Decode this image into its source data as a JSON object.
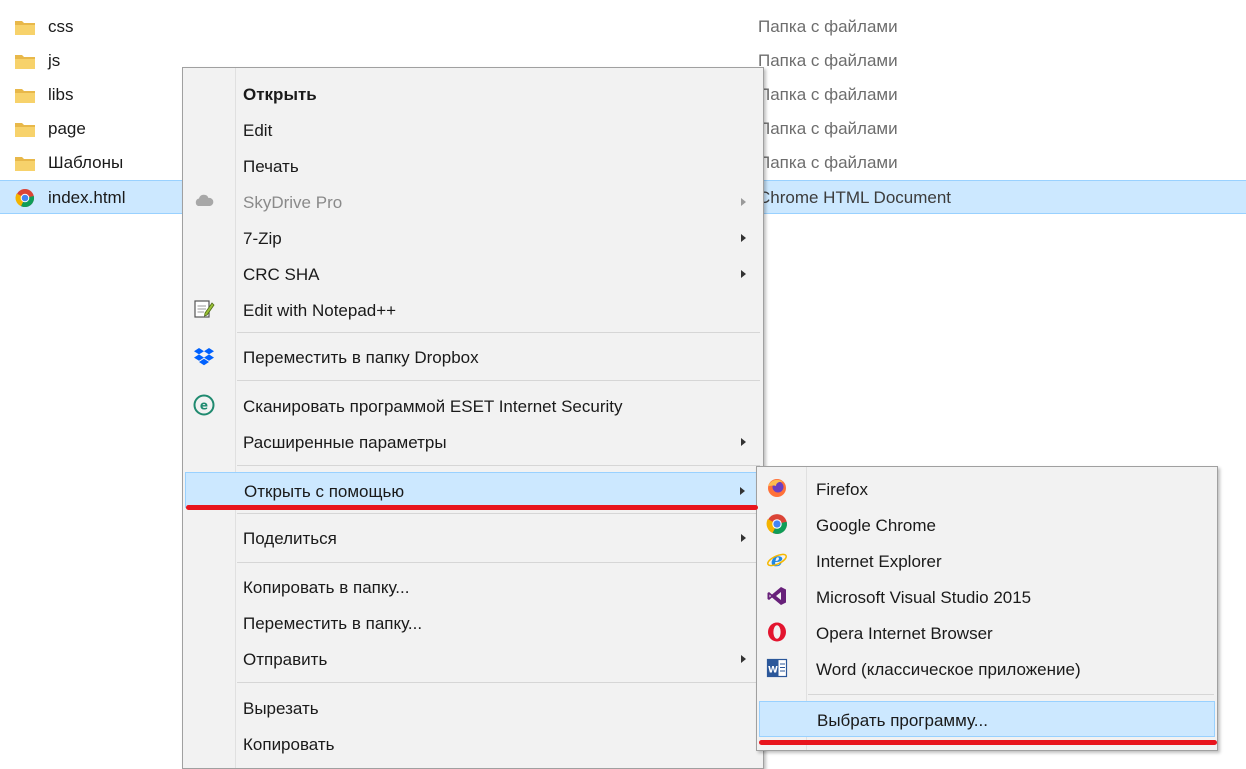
{
  "files": [
    {
      "name": "css",
      "type": "Папка с файлами",
      "icon": "folder-icon"
    },
    {
      "name": "js",
      "type": "Папка с файлами",
      "icon": "folder-icon"
    },
    {
      "name": "libs",
      "type": "Папка с файлами",
      "icon": "folder-icon"
    },
    {
      "name": "page",
      "type": "Папка с файлами",
      "icon": "folder-icon"
    },
    {
      "name": "Шаблоны",
      "type": "Папка с файлами",
      "icon": "folder-icon"
    },
    {
      "name": "index.html",
      "type": "Chrome HTML Document",
      "icon": "chrome-icon",
      "selected": true
    }
  ],
  "context_menu": {
    "open": "Открыть",
    "edit": "Edit",
    "print": "Печать",
    "skydrive": "SkyDrive Pro",
    "zip": "7-Zip",
    "crc": "CRC SHA",
    "notepad": "Edit with Notepad++",
    "dropbox": "Переместить в папку Dropbox",
    "eset": "Сканировать программой ESET Internet Security",
    "advanced": "Расширенные параметры",
    "open_with": "Открыть с помощью",
    "share": "Поделиться",
    "copy_to": "Копировать в папку...",
    "move_to": "Переместить в папку...",
    "send_to": "Отправить",
    "cut": "Вырезать",
    "copy": "Копировать"
  },
  "submenu": {
    "firefox": "Firefox",
    "chrome": "Google Chrome",
    "ie": "Internet Explorer",
    "vs": "Microsoft Visual Studio 2015",
    "opera": "Opera Internet Browser",
    "word": "Word (классическое приложение)",
    "choose": "Выбрать программу..."
  },
  "colors": {
    "selection": "#cce8ff",
    "menu_bg": "#f2f2f2",
    "annotation_red": "#e8151d"
  }
}
